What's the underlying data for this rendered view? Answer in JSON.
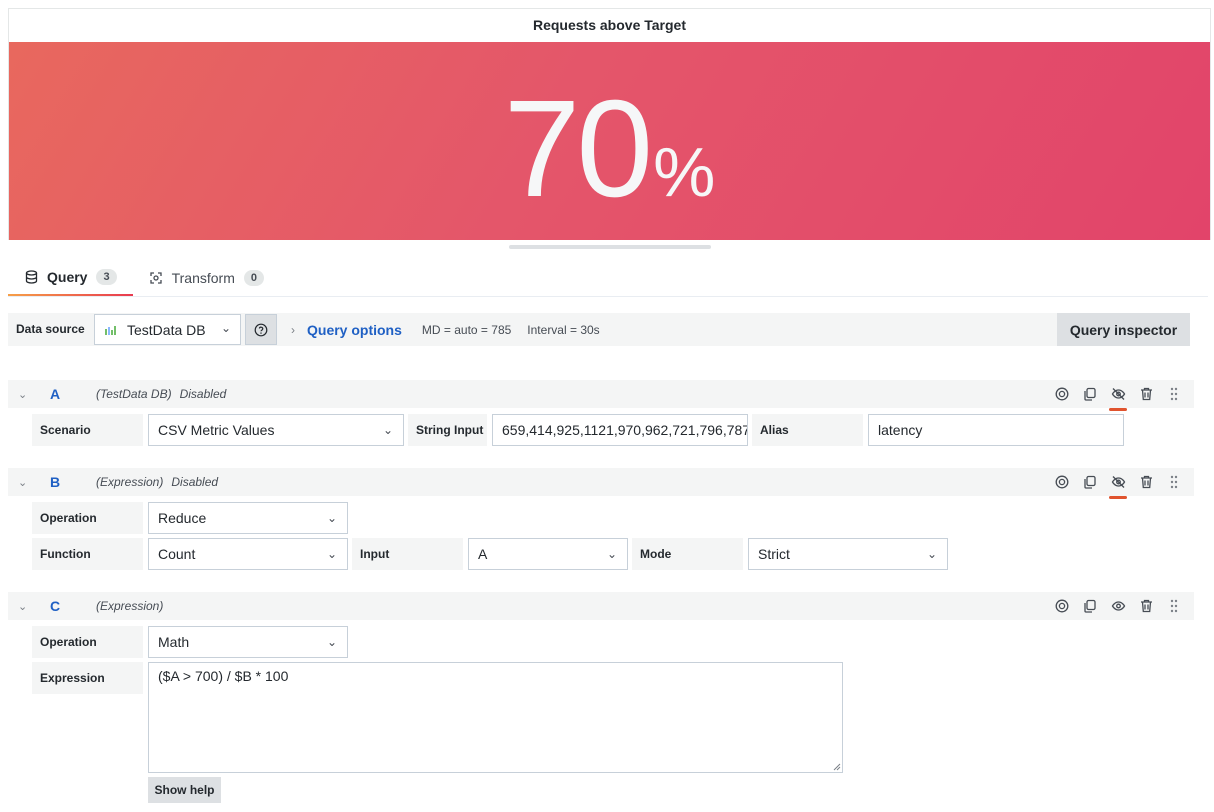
{
  "panel": {
    "title": "Requests above Target",
    "value": "70",
    "unit": "%"
  },
  "tabs": [
    {
      "label": "Query",
      "count": "3"
    },
    {
      "label": "Transform",
      "count": "0"
    }
  ],
  "toolbar": {
    "datasource_label": "Data source",
    "datasource_value": "TestData DB",
    "query_options_title": "Query options",
    "md": "MD = auto = 785",
    "interval": "Interval = 30s",
    "query_inspector": "Query inspector"
  },
  "queries": {
    "a": {
      "ref": "A",
      "datasource": "(TestData DB)",
      "status": "Disabled",
      "scenario_label": "Scenario",
      "scenario_value": "CSV Metric Values",
      "string_input_label": "String Input",
      "string_input_value": "659,414,925,1121,970,962,721,796,787",
      "alias_label": "Alias",
      "alias_value": "latency"
    },
    "b": {
      "ref": "B",
      "datasource": "(Expression)",
      "status": "Disabled",
      "operation_label": "Operation",
      "operation_value": "Reduce",
      "function_label": "Function",
      "function_value": "Count",
      "input_label": "Input",
      "input_value": "A",
      "mode_label": "Mode",
      "mode_value": "Strict"
    },
    "c": {
      "ref": "C",
      "datasource": "(Expression)",
      "operation_label": "Operation",
      "operation_value": "Math",
      "expression_label": "Expression",
      "expression_value": "($A > 700) / $B * 100",
      "show_help": "Show help"
    }
  },
  "colors": {
    "stat_start": "#e8685e",
    "stat_end": "#e2446a",
    "link_blue": "#1f60c4",
    "tab_accent": "#e8394f"
  }
}
